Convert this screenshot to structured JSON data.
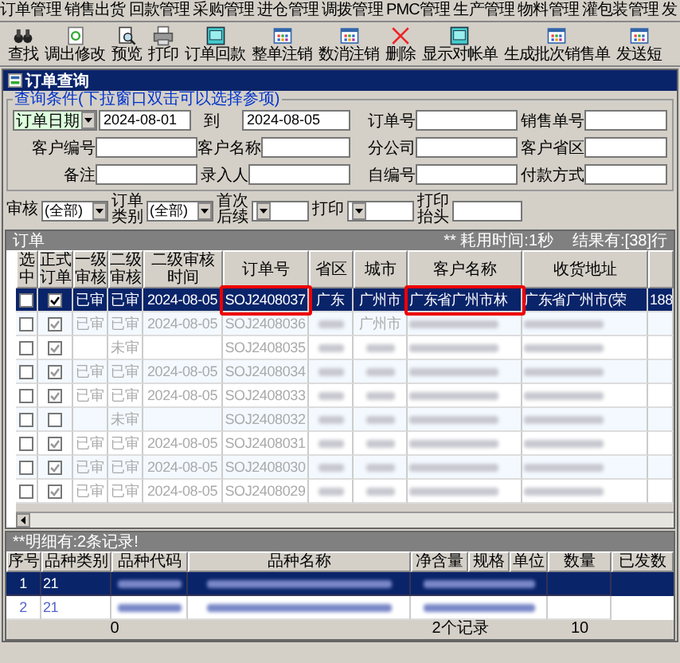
{
  "menu": [
    "订单管理",
    "销售出货",
    "回款管理",
    "采购管理",
    "进仓管理",
    "调拨管理",
    "PMC管理",
    "生产管理",
    "物料管理",
    "灌包装管理",
    "发"
  ],
  "toolbar": [
    {
      "label": "查找",
      "kind": "binoculars"
    },
    {
      "label": "调出修改",
      "kind": "page"
    },
    {
      "label": "预览",
      "kind": "preview"
    },
    {
      "label": "打印",
      "kind": "printer"
    },
    {
      "label": "订单回款",
      "kind": "ledger"
    },
    {
      "label": "整单注销",
      "kind": "grid"
    },
    {
      "label": "数消注销",
      "kind": "grid"
    },
    {
      "label": "删除",
      "kind": "delete"
    },
    {
      "label": "显示对帐单",
      "kind": "ledger"
    },
    {
      "label": "生成批次销售单",
      "kind": "grid"
    },
    {
      "label": "发送短",
      "kind": "grid"
    }
  ],
  "window": {
    "title": "订单查询"
  },
  "query": {
    "legend": "查询条件(下拉窗口双击可以选择参项)",
    "date_type": "订单日期",
    "date_from": "2024-08-01",
    "to_label": "到",
    "date_to": "2024-08-05",
    "fields": [
      {
        "label": "订单号"
      },
      {
        "label": "销售单号"
      },
      {
        "label": "客户编号"
      },
      {
        "label": "客户名称"
      },
      {
        "label": "分公司"
      },
      {
        "label": "客户省区"
      },
      {
        "label": "备注"
      },
      {
        "label": "录入人"
      },
      {
        "label": "自编号"
      },
      {
        "label": "付款方式"
      }
    ]
  },
  "filters": [
    {
      "label": "审核",
      "value": "(全部)"
    },
    {
      "label": "订单类别",
      "value": "(全部)"
    },
    {
      "label": "首次后续"
    },
    {
      "label": "打印"
    },
    {
      "label": "打印抬头"
    }
  ],
  "orders": {
    "title": "订单",
    "elapsed": "** 耗用时间:1秒",
    "result": "结果有:[38]行",
    "columns": [
      {
        "label": "选中",
        "highlighted": false
      },
      {
        "label": "正式订单",
        "highlighted": false
      },
      {
        "label": "一级审核",
        "highlighted": false
      },
      {
        "label": "二级审核",
        "highlighted": false
      },
      {
        "label": "二级审核时间",
        "highlighted": false
      },
      {
        "label": "订单号",
        "highlighted": true
      },
      {
        "label": "省区",
        "highlighted": false
      },
      {
        "label": "城市",
        "highlighted": false
      },
      {
        "label": "客户名称",
        "highlighted": true
      },
      {
        "label": "收货地址",
        "highlighted": false
      }
    ],
    "rows": [
      {
        "selected": true,
        "checked": false,
        "formal": true,
        "audit1": "已审",
        "audit2": "已审",
        "time": "2024-08-05",
        "order": "SOJ2408037",
        "province": "广东",
        "city": "广州市",
        "customer": "广东省广州市林",
        "address": "广东省广州市(荣",
        "column_11": "188"
      },
      {
        "selected": false,
        "checked": false,
        "formal": true,
        "audit1": "已审",
        "audit2": "已审",
        "time": "2024-08-05",
        "order": "SOJ2408036",
        "city": "广州市"
      },
      {
        "selected": false,
        "checked": false,
        "formal": true,
        "audit2": "未审",
        "order": "SOJ2408035"
      },
      {
        "selected": false,
        "checked": false,
        "formal": true,
        "audit1": "已审",
        "audit2": "已审",
        "time": "2024-08-05",
        "order": "SOJ2408034"
      },
      {
        "selected": false,
        "checked": false,
        "formal": true,
        "audit1": "已审",
        "audit2": "已审",
        "time": "2024-08-05",
        "order": "SOJ2408033"
      },
      {
        "selected": false,
        "checked": false,
        "formal": false,
        "audit2": "未审",
        "order": "SOJ2408032"
      },
      {
        "selected": false,
        "checked": false,
        "formal": true,
        "audit1": "已审",
        "audit2": "已审",
        "time": "2024-08-05",
        "order": "SOJ2408031"
      },
      {
        "selected": false,
        "checked": false,
        "formal": true,
        "audit1": "已审",
        "audit2": "已审",
        "time": "2024-08-05",
        "order": "SOJ2408030"
      },
      {
        "selected": false,
        "checked": false,
        "formal": true,
        "audit1": "已审",
        "audit2": "已审",
        "time": "2024-08-05",
        "order": "SOJ2408029"
      }
    ]
  },
  "details": {
    "title": "**明细有:2条记录!",
    "columns": [
      "序号",
      "品种类别",
      "品种代码",
      "品种名称",
      "净含量",
      "规格",
      "单位",
      "数量",
      "已发数"
    ],
    "rows": [
      {
        "selected": true,
        "no": "1",
        "category": "21"
      },
      {
        "selected": false,
        "no": "2",
        "category": "21"
      }
    ],
    "footer": {
      "category": "0",
      "net": "2个记录",
      "quantity": "10"
    }
  }
}
